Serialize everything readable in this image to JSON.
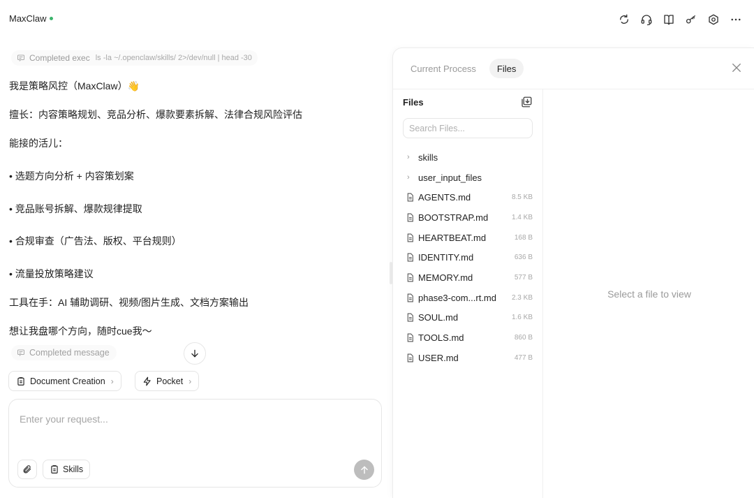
{
  "header": {
    "title": "MaxClaw",
    "icons": [
      "refresh-icon",
      "headset-icon",
      "book-icon",
      "key-icon",
      "settings-icon",
      "more-icon"
    ]
  },
  "chat": {
    "exec_chip": {
      "label": "Completed exec",
      "command": "ls -la ~/.openclaw/skills/ 2>/dev/null | head -30"
    },
    "messages": [
      "我是策略风控（MaxClaw）👋",
      "擅长：内容策略规划、竞品分析、爆款要素拆解、法律合规风险评估",
      "能接的活儿：",
      "• 选题方向分析 + 内容策划案",
      "• 竞品账号拆解、爆款规律提取",
      "• 合规审查（广告法、版权、平台规则）",
      "• 流量投放策略建议",
      "工具在手：AI 辅助调研、视频/图片生成、文档方案输出",
      "想让我盘哪个方向，随时cue我～"
    ],
    "done_chip": "Completed message",
    "suggestions": [
      {
        "label": "Document Creation",
        "icon": "document-icon"
      },
      {
        "label": "Pocket",
        "icon": "bolt-icon"
      }
    ],
    "composer": {
      "placeholder": "Enter your request...",
      "skills_label": "Skills"
    }
  },
  "panel": {
    "tabs": [
      {
        "label": "Current Process",
        "active": false
      },
      {
        "label": "Files",
        "active": true
      }
    ],
    "file_tree": {
      "title": "Files",
      "search_placeholder": "Search Files...",
      "items": [
        {
          "type": "folder",
          "name": "skills",
          "size": ""
        },
        {
          "type": "folder",
          "name": "user_input_files",
          "size": ""
        },
        {
          "type": "file",
          "name": "AGENTS.md",
          "size": "8.5 KB"
        },
        {
          "type": "file",
          "name": "BOOTSTRAP.md",
          "size": "1.4 KB"
        },
        {
          "type": "file",
          "name": "HEARTBEAT.md",
          "size": "168 B"
        },
        {
          "type": "file",
          "name": "IDENTITY.md",
          "size": "636 B"
        },
        {
          "type": "file",
          "name": "MEMORY.md",
          "size": "577 B"
        },
        {
          "type": "file",
          "name": "phase3-com...rt.md",
          "size": "2.3 KB"
        },
        {
          "type": "file",
          "name": "SOUL.md",
          "size": "1.6 KB"
        },
        {
          "type": "file",
          "name": "TOOLS.md",
          "size": "860 B"
        },
        {
          "type": "file",
          "name": "USER.md",
          "size": "477 B"
        }
      ]
    },
    "viewer_empty": "Select a file to view"
  },
  "colors": {
    "status_dot": "#3bb46c",
    "active_tab_bg": "#f2f2f2",
    "send_button": "#bdbdbd"
  }
}
